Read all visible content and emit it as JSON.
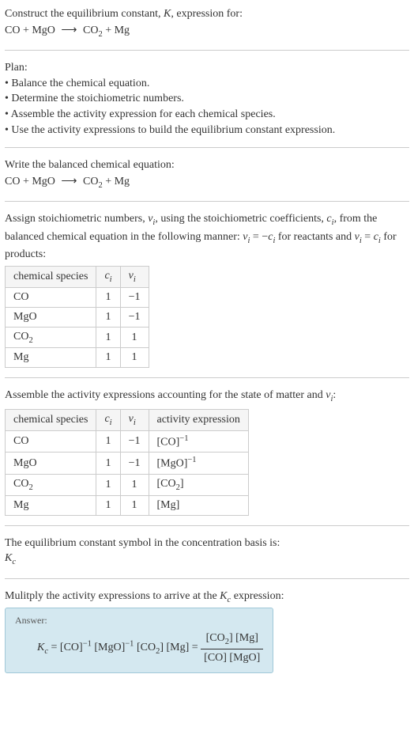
{
  "intro": {
    "line1": "Construct the equilibrium constant, ",
    "k": "K",
    "line1b": ", expression for:",
    "equation_lhs": "CO + MgO",
    "arrow": "⟶",
    "equation_rhs_a": "CO",
    "equation_rhs_a_sub": "2",
    "equation_rhs_b": " + Mg"
  },
  "plan": {
    "heading": "Plan:",
    "items": [
      "• Balance the chemical equation.",
      "• Determine the stoichiometric numbers.",
      "• Assemble the activity expression for each chemical species.",
      "• Use the activity expressions to build the equilibrium constant expression."
    ]
  },
  "balanced": {
    "heading": "Write the balanced chemical equation:",
    "equation_lhs": "CO + MgO",
    "arrow": "⟶",
    "equation_rhs_a": "CO",
    "equation_rhs_a_sub": "2",
    "equation_rhs_b": " + Mg"
  },
  "stoich": {
    "text_a": "Assign stoichiometric numbers, ",
    "nu": "ν",
    "i": "i",
    "text_b": ", using the stoichiometric coefficients, ",
    "c": "c",
    "text_c": ", from the balanced chemical equation in the following manner: ",
    "eq1_lhs_nu": "ν",
    "eq1_eq": " = −",
    "eq1_rhs_c": "c",
    "text_d": " for reactants and ",
    "eq2_eq": " = ",
    "text_e": " for products:",
    "table": {
      "headers": [
        "chemical species",
        "cᵢ",
        "νᵢ"
      ],
      "rows": [
        [
          "CO",
          "1",
          "−1"
        ],
        [
          "MgO",
          "1",
          "−1"
        ],
        [
          "CO₂",
          "1",
          "1"
        ],
        [
          "Mg",
          "1",
          "1"
        ]
      ]
    }
  },
  "activity": {
    "text_a": "Assemble the activity expressions accounting for the state of matter and ",
    "nu": "ν",
    "i": "i",
    "text_b": ":",
    "table": {
      "headers": [
        "chemical species",
        "cᵢ",
        "νᵢ",
        "activity expression"
      ],
      "rows": [
        {
          "species": "CO",
          "c": "1",
          "nu": "−1",
          "expr_base": "[CO]",
          "expr_sup": "−1"
        },
        {
          "species": "MgO",
          "c": "1",
          "nu": "−1",
          "expr_base": "[MgO]",
          "expr_sup": "−1"
        },
        {
          "species": "CO₂",
          "c": "1",
          "nu": "1",
          "expr_base": "[CO₂]",
          "expr_sup": ""
        },
        {
          "species": "Mg",
          "c": "1",
          "nu": "1",
          "expr_base": "[Mg]",
          "expr_sup": ""
        }
      ]
    }
  },
  "symbol": {
    "text": "The equilibrium constant symbol in the concentration basis is:",
    "kc_k": "K",
    "kc_c": "c"
  },
  "multiply": {
    "text_a": "Mulitply the activity expressions to arrive at the ",
    "kc_k": "K",
    "kc_c": "c",
    "text_b": " expression:"
  },
  "answer": {
    "label": "Answer:",
    "kc_k": "K",
    "kc_c": "c",
    "eq": " = ",
    "t1": "[CO]",
    "t1_sup": "−1",
    "t2": " [MgO]",
    "t2_sup": "−1",
    "t3": " [CO",
    "t3_sub": "2",
    "t3b": "] [Mg] = ",
    "frac_num_a": "[CO",
    "frac_num_a_sub": "2",
    "frac_num_b": "] [Mg]",
    "frac_den": "[CO] [MgO]"
  }
}
